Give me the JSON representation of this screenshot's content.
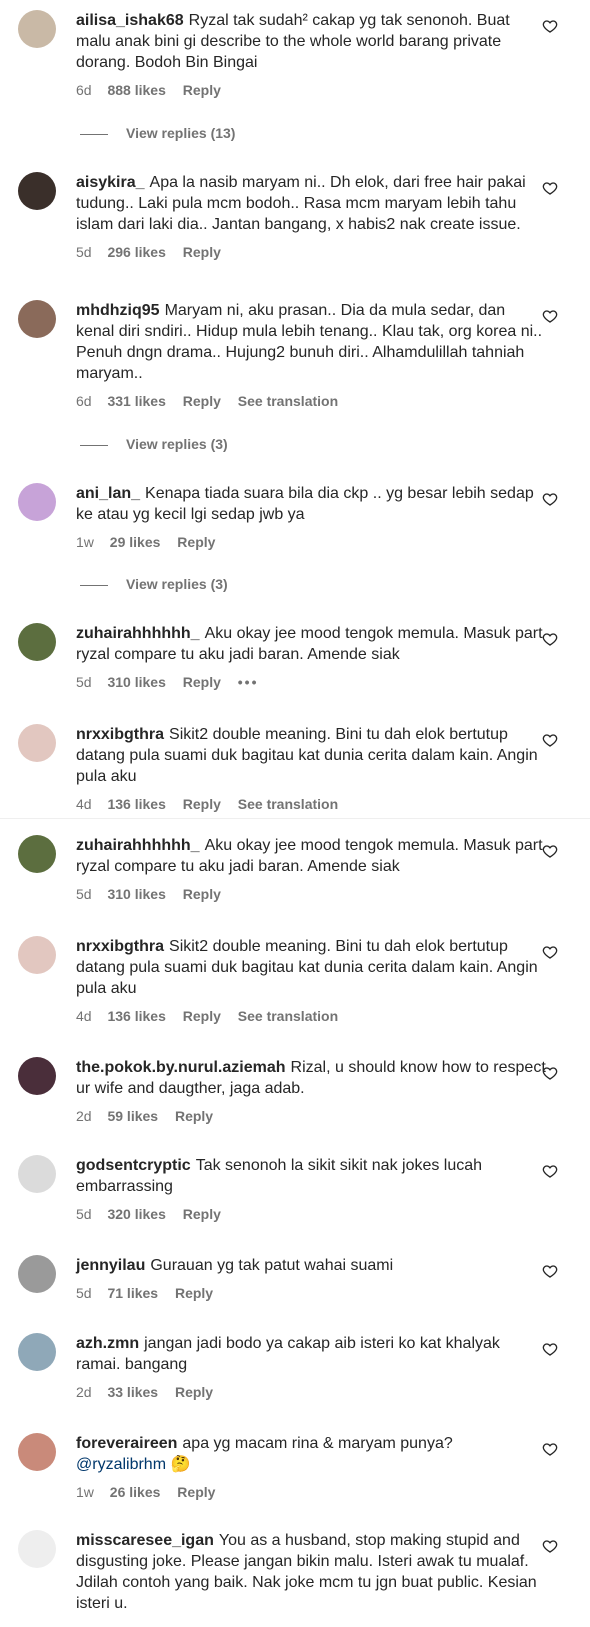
{
  "labels": {
    "reply": "Reply",
    "see_translation": "See translation",
    "more": "•••"
  },
  "comments": [
    {
      "user": "ailisa_ishak68",
      "text": "Ryzal tak sudah² cakap yg tak senonoh. Buat malu anak bini gi describe to the whole world barang private dorang. Bodoh Bin Bingai",
      "time": "6d",
      "likes": "888 likes",
      "avatar_color": "#c9b9a6"
    },
    {
      "user": "aisykira_",
      "text": "Apa la nasib maryam ni.. Dh elok, dari free hair pakai tudung.. Laki pula mcm bodoh.. Rasa mcm maryam lebih tahu islam dari laki dia.. Jantan bangang, x habis2 nak create issue.",
      "time": "5d",
      "likes": "296 likes",
      "avatar_color": "#3a2f2a"
    },
    {
      "user": "mhdhziq95",
      "text": "Maryam ni, aku prasan.. Dia da mula sedar, dan kenal diri sndiri.. Hidup mula lebih tenang.. Klau tak, org korea ni.. Penuh dngn drama.. Hujung2 bunuh diri.. Alhamdulillah tahniah maryam..",
      "time": "6d",
      "likes": "331 likes",
      "avatar_color": "#8a6a5a"
    },
    {
      "user": "ani_lan_",
      "text": "Kenapa tiada suara bila dia ckp .. yg besar lebih sedap ke atau yg kecil lgi sedap jwb ya",
      "time": "1w",
      "likes": "29 likes",
      "avatar_color": "#c7a3d8"
    },
    {
      "user": "zuhairahhhhhh_",
      "text": "Aku okay jee mood tengok memula. Masuk part ryzal compare tu aku jadi baran. Amende siak",
      "time": "5d",
      "likes": "310 likes",
      "avatar_color": "#5c6e3f"
    },
    {
      "user": "nrxxibgthra",
      "text": "Sikit2 double meaning. Bini tu dah elok bertutup datang pula suami duk bagitau kat dunia cerita dalam kain. Angin pula aku",
      "time": "4d",
      "likes": "136 likes",
      "avatar_color": "#e2c7c0"
    },
    {
      "user": "zuhairahhhhhh_",
      "text": "Aku okay jee mood tengok memula. Masuk part ryzal compare tu aku jadi baran. Amende siak",
      "time": "5d",
      "likes": "310 likes",
      "avatar_color": "#5c6e3f"
    },
    {
      "user": "nrxxibgthra",
      "text": "Sikit2 double meaning. Bini tu dah elok bertutup datang pula suami duk bagitau kat dunia cerita dalam kain. Angin pula aku",
      "time": "4d",
      "likes": "136 likes",
      "avatar_color": "#e2c7c0"
    },
    {
      "user": "the.pokok.by.nurul.aziemah",
      "text": "Rizal, u should know how to respect ur wife and daugther, jaga adab.",
      "time": "2d",
      "likes": "59 likes",
      "avatar_color": "#4a2e3a"
    },
    {
      "user": "godsentcryptic",
      "text": "Tak senonoh la sikit sikit nak jokes lucah embarrassing",
      "time": "5d",
      "likes": "320 likes",
      "avatar_color": "#dbdbdb"
    },
    {
      "user": "jennyilau",
      "text": "Gurauan yg tak patut wahai suami",
      "time": "5d",
      "likes": "71 likes",
      "avatar_color": "#9a9a9a"
    },
    {
      "user": "azh.zmn",
      "text": "jangan jadi bodo ya cakap aib isteri ko kat khalyak ramai. bangang",
      "time": "2d",
      "likes": "33 likes",
      "avatar_color": "#8fa8b8"
    },
    {
      "user": "foreveraireen",
      "text": "apa yg macam rina & maryam punya?",
      "mention": "@ryzalibrhm",
      "emoji": "🤔",
      "time": "1w",
      "likes": "26 likes",
      "avatar_color": "#c98a7a"
    },
    {
      "user": "misscaresee_igan",
      "text": "You as a husband, stop making stupid and disgusting joke. Please jangan bikin malu. Isteri awak tu mualaf. Jdilah contoh yang baik. Nak joke mcm tu jgn buat public. Kesian isteri u.",
      "time": "",
      "likes": "",
      "avatar_color": "#eeeeee"
    }
  ],
  "view_replies": [
    {
      "label": "View replies (13)"
    },
    {
      "label": "View replies (3)"
    },
    {
      "label": "View replies (3)"
    }
  ]
}
